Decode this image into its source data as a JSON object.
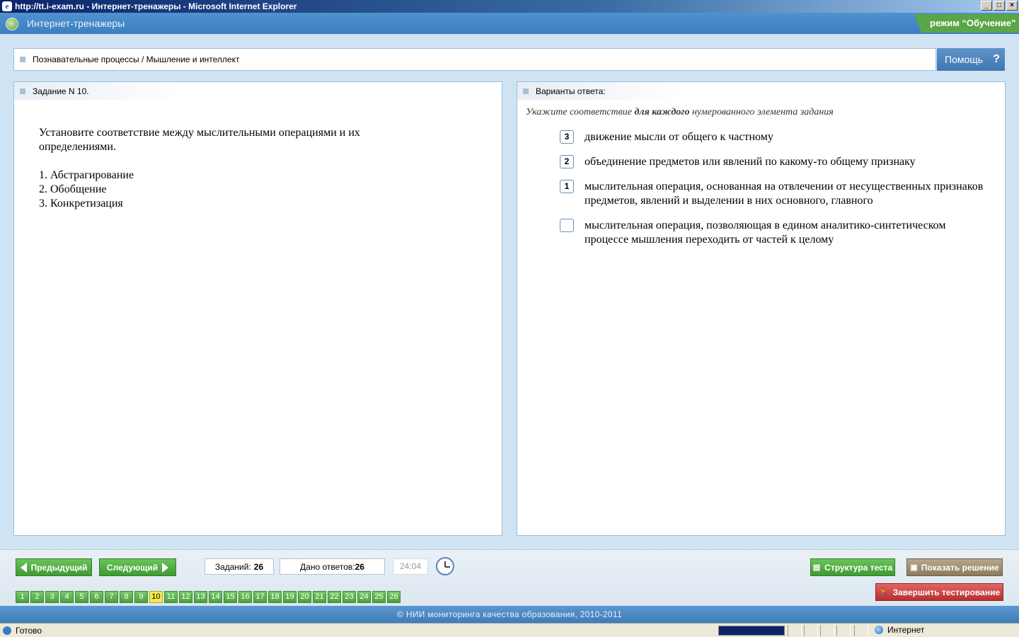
{
  "window": {
    "title": "http://tt.i-exam.ru - Интернет-тренажеры - Microsoft Internet Explorer",
    "minimize": "_",
    "maximize": "□",
    "close": "×"
  },
  "header": {
    "app_title": "Интернет-тренажеры",
    "mode": "режим “Обучение”"
  },
  "breadcrumb": "Познавательные процессы / Мышление и интеллект",
  "help": {
    "label": "Помощь",
    "icon": "?"
  },
  "task": {
    "heading": "Задание N 10.",
    "prompt": "Установите соответствие между мыслительными операциями и их определениями.",
    "items": [
      "1. Абстрагирование",
      "2. Обобщение",
      "3. Конкретизация"
    ]
  },
  "answers": {
    "heading": "Варианты ответа:",
    "instruction_pre": "Укажите соответствие ",
    "instruction_bold": "для каждого",
    "instruction_post": " нумерованного элемента задания",
    "options": [
      {
        "value": "3",
        "text": "движение мысли от общего к частному"
      },
      {
        "value": "2",
        "text": "объединение предметов или явлений по какому-то общему признаку"
      },
      {
        "value": "1",
        "text": "мыслительная операция, основанная на отвлечении от несущественных признаков предметов, явлений и выделении в них основного, главного"
      },
      {
        "value": "",
        "text": "мыслительная операция, позволяющая в едином аналитико-синтетическом процессе мышления переходить от частей к целому"
      }
    ]
  },
  "nav": {
    "prev": "Предыдущий",
    "next": "Следующий",
    "tasks_label": "Заданий:",
    "tasks_count": "26",
    "answered_label": "Дано ответов:",
    "answered_count": "26",
    "timer": "24:04",
    "pages": [
      "1",
      "2",
      "3",
      "4",
      "5",
      "6",
      "7",
      "8",
      "9",
      "10",
      "11",
      "12",
      "13",
      "14",
      "15",
      "16",
      "17",
      "18",
      "19",
      "20",
      "21",
      "22",
      "23",
      "24",
      "25",
      "26"
    ],
    "current_page": "10",
    "structure": "Структура теста",
    "solution": "Показать решение",
    "finish": "Завершить тестирование"
  },
  "footer": "© НИИ мониторинга качества образования, 2010-2011",
  "status": {
    "text": "Готово",
    "zone": "Интернет"
  }
}
